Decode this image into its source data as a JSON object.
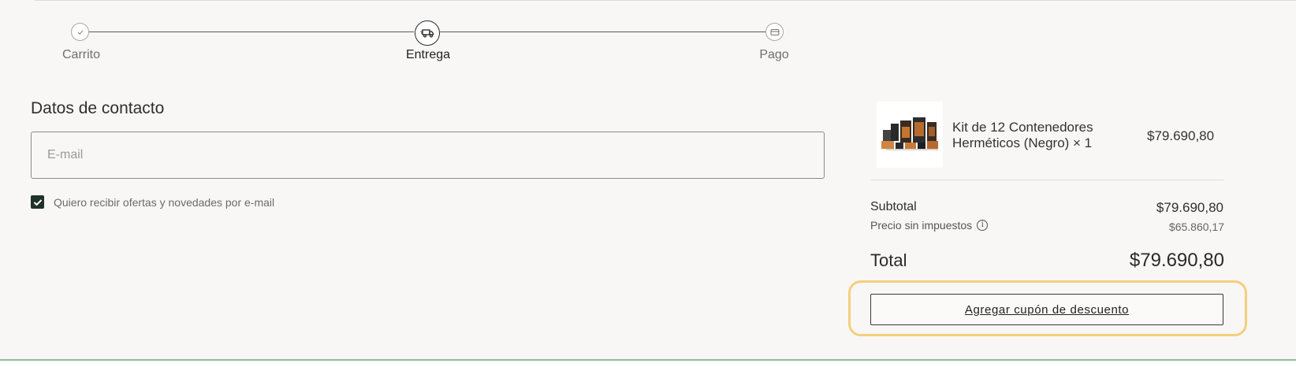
{
  "stepper": {
    "steps": [
      {
        "label": "Carrito",
        "state": "completed",
        "icon": "check-icon"
      },
      {
        "label": "Entrega",
        "state": "active",
        "icon": "truck-icon"
      },
      {
        "label": "Pago",
        "state": "pending",
        "icon": "card-icon"
      }
    ]
  },
  "contact": {
    "title": "Datos de contacto",
    "email_placeholder": "E-mail",
    "email_value": "",
    "newsletter_label": "Quiero recibir ofertas y novedades por e-mail",
    "newsletter_checked": true
  },
  "summary": {
    "product": {
      "name": "Kit de 12 Contenedores Herméticos (Negro) × 1",
      "price": "$79.690,80",
      "image_icon": "product-thumbnail"
    },
    "subtotal_label": "Subtotal",
    "subtotal_value": "$79.690,80",
    "tax_label": "Precio sin impuestos",
    "tax_value": "$65.860,17",
    "total_label": "Total",
    "total_value": "$79.690,80",
    "coupon_label": "Agregar cupón de descuento"
  },
  "colors": {
    "background": "#f8f7f5",
    "checkbox": "#1f3328",
    "highlight": "#f3cf7e",
    "bottom_bar": "#8fbba1"
  }
}
